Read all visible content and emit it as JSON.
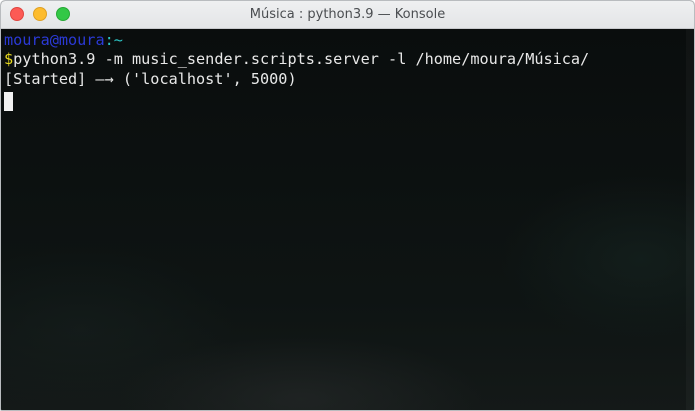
{
  "window": {
    "title": "Música : python3.9 — Konsole",
    "buttons": [
      "close",
      "minimize",
      "maximize"
    ]
  },
  "terminal": {
    "prompt": {
      "user": "moura",
      "at": "@",
      "host": "moura",
      "colon": ":",
      "cwd": "~"
    },
    "prompt_symbol": "$",
    "command": "python3.9 -m music_sender.scripts.server -l /home/moura/Música/",
    "output": [
      "[Started] —→ ('localhost', 5000)"
    ]
  },
  "colors": {
    "user": "#2b3ad6",
    "path": "#2cc3c3",
    "prompt_symbol": "#e6d81e",
    "text": "#e8e8e8",
    "background": "#0b0e0e"
  }
}
